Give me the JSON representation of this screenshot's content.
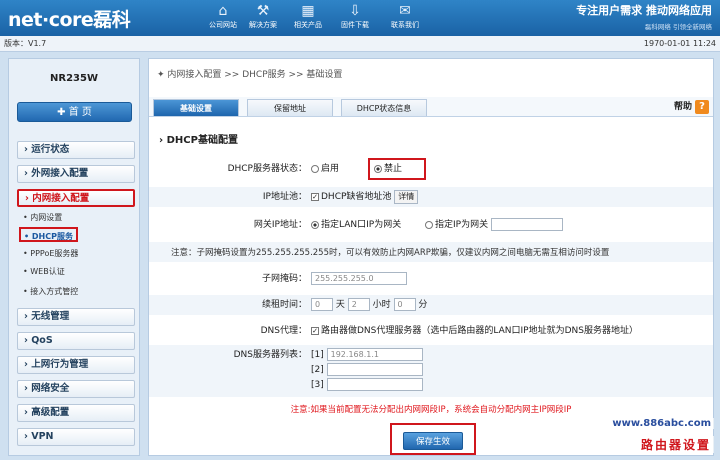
{
  "header": {
    "logo": "net·core磊科",
    "nav": [
      {
        "icon": "⌂",
        "label": "公司网站"
      },
      {
        "icon": "⚒",
        "label": "解决方案"
      },
      {
        "icon": "▦",
        "label": "相关产品"
      },
      {
        "icon": "⇩",
        "label": "固件下载"
      },
      {
        "icon": "✉",
        "label": "联系我们"
      }
    ],
    "slogan": "专注用户需求 推动网络应用",
    "slogan_sub": "磊科网络 引领全新网络"
  },
  "version": "版本：V1.7",
  "clock": "1970-01-01 11:24",
  "sidebar": {
    "model": "NR235W",
    "home": "首 页",
    "menus": [
      "› 运行状态",
      "› 外网接入配置",
      "› 内网接入配置",
      "› 无线管理",
      "› QoS",
      "› 上网行为管理",
      "› 网络安全",
      "› 高级配置",
      "› VPN"
    ],
    "subs": [
      "• 内网设置",
      "• DHCP服务",
      "• PPPoE服务器",
      "• WEB认证",
      "• 接入方式管控"
    ]
  },
  "breadcrumb": "✦ 内网接入配置 >> DHCP服务 >> 基础设置",
  "tabs": [
    "基础设置",
    "保留地址",
    "DHCP状态信息"
  ],
  "help": "帮助",
  "help_icon": "?",
  "section": "› DHCP基础配置",
  "form": {
    "status_label": "DHCP服务器状态：",
    "enable": "启用",
    "disable": "禁止",
    "pool_label": "IP地址池：",
    "pool_check": "DHCP缺省地址池",
    "detail": "详情",
    "gw_label": "网关IP地址：",
    "gw_opt1": "指定LAN口IP为网关",
    "gw_opt2": "指定IP为网关",
    "note": "注意：子网掩码设置为255.255.255.255时，可以有效防止内网ARP欺骗，仅建议内网之间电脑无需互相访问时设置",
    "mask_label": "子网掩码：",
    "mask": "255.255.255.0",
    "lease_label": "续租时间：",
    "lease_d": "0",
    "day": "天",
    "lease_h": "2",
    "hour": "小时",
    "lease_m": "0",
    "minute": "分",
    "dns_proxy_label": "DNS代理：",
    "dns_proxy": "路由器做DNS代理服务器（选中后路由器的LAN口IP地址就为DNS服务器地址）",
    "dns_list_label": "DNS服务器列表：",
    "dns1_idx": "[1]",
    "dns1": "192.168.1.1",
    "dns2_idx": "[2]",
    "dns3_idx": "[3]",
    "warning": "注意:如果当前配置无法分配出内网网段IP，系统会自动分配内网主IP网段IP",
    "save": "保存生效"
  },
  "watermark": {
    "url": "www.886abc.com",
    "text": "路由器设置"
  }
}
